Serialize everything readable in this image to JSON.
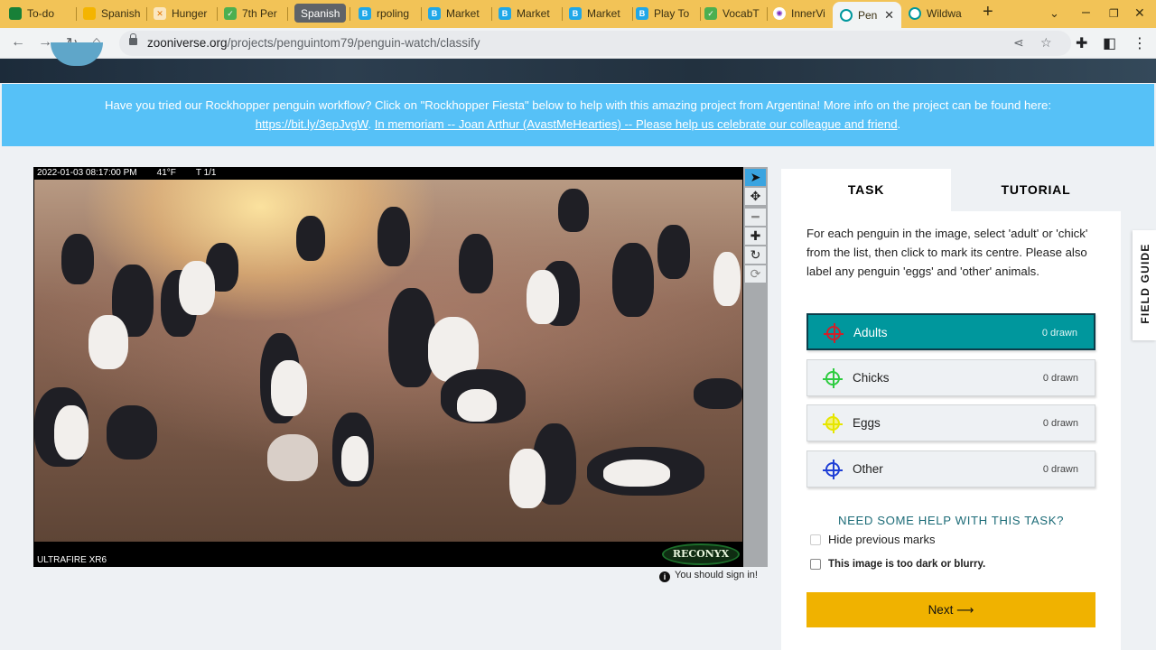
{
  "browser": {
    "tabs": [
      {
        "label": "To-do",
        "icon": "tasks-icon",
        "color": "#188038"
      },
      {
        "label": "Spanish",
        "icon": "slides-icon",
        "color": "#f4b400"
      },
      {
        "label": "Hunger",
        "icon": "x-icon",
        "color": "#e37400"
      },
      {
        "label": "7th Per",
        "icon": "check-icon",
        "color": "#4caf50"
      },
      {
        "label": "Spanish",
        "icon": "pill-tab",
        "color": "#5f6368"
      },
      {
        "label": "rpoling",
        "icon": "b-icon",
        "color": "#1fa7e8"
      },
      {
        "label": "Market",
        "icon": "b-icon",
        "color": "#1fa7e8"
      },
      {
        "label": "Market",
        "icon": "b-icon",
        "color": "#1fa7e8"
      },
      {
        "label": "Market",
        "icon": "b-icon",
        "color": "#1fa7e8"
      },
      {
        "label": "Play To",
        "icon": "b-icon",
        "color": "#1fa7e8"
      },
      {
        "label": "VocabT",
        "icon": "check-icon",
        "color": "#4caf50"
      },
      {
        "label": "InnerVi",
        "icon": "innervi-icon",
        "color": "#7b2cbf"
      },
      {
        "label": "Pen",
        "icon": "zooniverse-icon",
        "color": "#00979d"
      },
      {
        "label": "Wildwa",
        "icon": "zooniverse-icon",
        "color": "#00979d"
      }
    ],
    "new_tab": "+",
    "url_host": "zooniverse.org",
    "url_path": "/projects/penguintom79/penguin-watch/classify"
  },
  "banner": {
    "text1": "Have you tried our Rockhopper penguin workflow? Click on \"Rockhopper Fiesta\" below to help with this amazing project from Argentina! More info on the project can be found here:",
    "link1": "https://bit.ly/3epJvgW",
    "sep": ". ",
    "link2": "In memoriam -- Joan Arthur (AvastMeHearties) -- Please help us celebrate our colleague and friend",
    "end": "."
  },
  "viewer": {
    "timestamp": "2022-01-03 08:17:00 PM",
    "temperature": "41°F",
    "frame": "T 1/1",
    "camera": "ULTRAFIRE XR6",
    "brand": "RECONYX",
    "signin": "You should sign in!"
  },
  "panel": {
    "tab_task": "TASK",
    "tab_tutorial": "TUTORIAL",
    "instructions": "For each penguin in the image, select 'adult' or 'chick' from the list, then click to mark its centre. Please also label any penguin 'eggs' and 'other' animals.",
    "tools": [
      {
        "label": "Adults",
        "count": "0 drawn",
        "color": "#d0202a"
      },
      {
        "label": "Chicks",
        "count": "0 drawn",
        "color": "#2ecc40"
      },
      {
        "label": "Eggs",
        "count": "0 drawn",
        "color": "#e6e600"
      },
      {
        "label": "Other",
        "count": "0 drawn",
        "color": "#1f3fd6"
      }
    ],
    "help": "NEED SOME HELP WITH THIS TASK?",
    "hide_marks": "Hide previous marks",
    "too_dark": "This image is too dark or blurry.",
    "next": "Next ⟶"
  },
  "field_guide": "FIELD GUIDE"
}
